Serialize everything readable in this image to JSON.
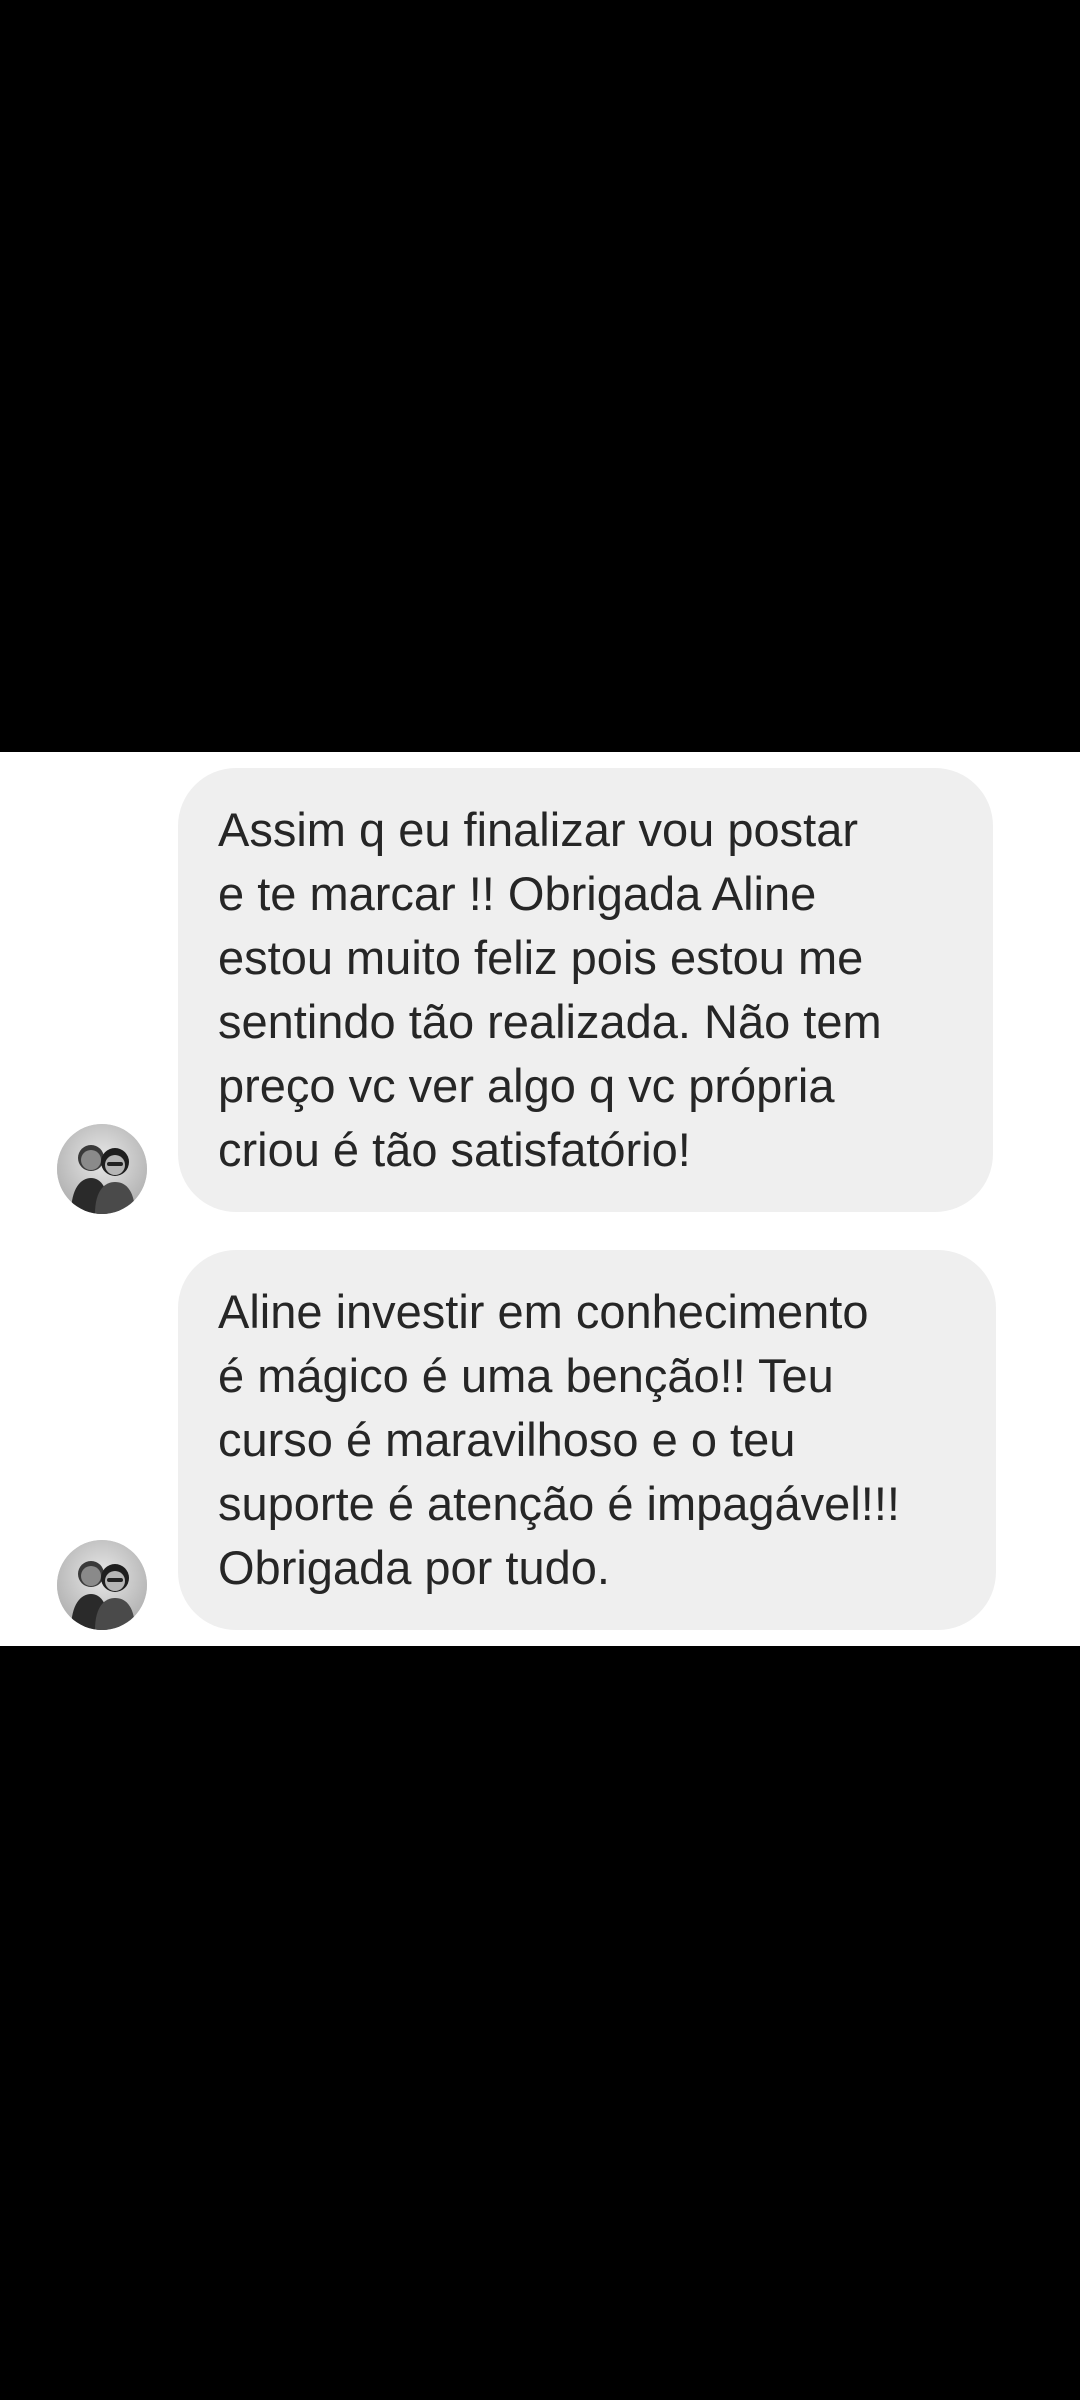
{
  "conversation": {
    "messages": [
      {
        "text": "Assim q eu finalizar vou postar\ne te marcar !! Obrigada Aline\nestou muito feliz pois estou me\nsentindo tão realizada. Não tem\npreço vc ver algo q vc própria\ncriou é tão satisfatório!",
        "avatar_icon": "couple-photo-avatar"
      },
      {
        "text": "Aline investir em conhecimento\né mágico é uma benção!! Teu\ncurso é maravilhoso e o teu\nsuporte é atenção é impagável!!!\nObrigada por tudo.",
        "avatar_icon": "couple-photo-avatar"
      }
    ]
  },
  "colors": {
    "background": "#000000",
    "panel": "#ffffff",
    "bubble": "#efefef",
    "text": "#262626"
  }
}
